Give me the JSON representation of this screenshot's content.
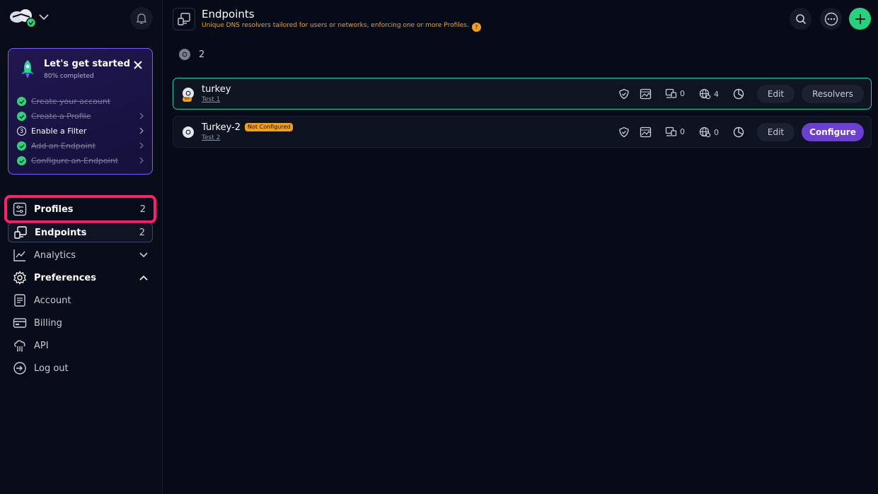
{
  "sidebar": {
    "getting_started": {
      "title": "Let's get started",
      "progress_text": "80% completed",
      "progress": 0.8,
      "items": [
        {
          "label": "Create your account",
          "done": true
        },
        {
          "label": "Create a Profile",
          "done": true
        },
        {
          "label": "Enable a Filter",
          "done": false,
          "step": "3"
        },
        {
          "label": "Add an Endpoint",
          "done": true
        },
        {
          "label": "Configure an Endpoint",
          "done": true
        }
      ]
    },
    "nav": {
      "profiles": {
        "label": "Profiles",
        "count": "2"
      },
      "endpoints": {
        "label": "Endpoints",
        "count": "2"
      },
      "analytics": {
        "label": "Analytics"
      },
      "preferences": {
        "label": "Preferences"
      },
      "account": {
        "label": "Account"
      },
      "billing": {
        "label": "Billing"
      },
      "api": {
        "label": "API"
      },
      "logout": {
        "label": "Log out"
      }
    }
  },
  "header": {
    "title": "Endpoints",
    "subtitle": "Unique DNS resolvers tailored for users or networks, enforcing one or more Profiles."
  },
  "summary": {
    "count": "2"
  },
  "endpoints": [
    {
      "name": "turkey",
      "profile": "Test 1",
      "badge": "tm",
      "devices": "0",
      "networks": "4",
      "edit_label": "Edit",
      "action_label": "Resolvers"
    },
    {
      "name": "Turkey-2",
      "status_badge": "Not Configured",
      "profile": "Test 2",
      "devices": "0",
      "networks": "0",
      "edit_label": "Edit",
      "action_label": "Configure"
    }
  ],
  "colors": {
    "background": "#070b17",
    "accent_green": "#27d17f",
    "accent_purple": "#6a3fd1",
    "warning": "#f0a020",
    "highlight": "#ff1f6a"
  }
}
